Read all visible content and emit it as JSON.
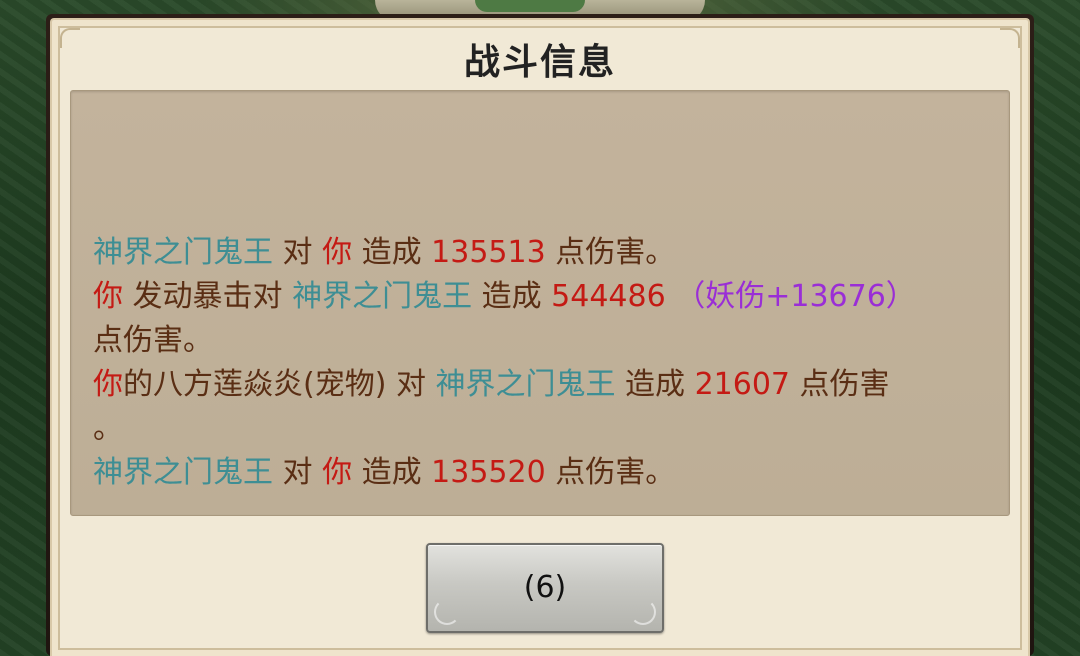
{
  "dialog": {
    "title": "战斗信息",
    "button_label": "(6)"
  },
  "log": [
    {
      "segments": [
        {
          "text": "神界之门鬼王",
          "role": "enemy"
        },
        {
          "text": " 对 ",
          "role": "text"
        },
        {
          "text": "你",
          "role": "you"
        },
        {
          "text": " 造成 ",
          "role": "text"
        },
        {
          "text": "135513",
          "role": "number"
        },
        {
          "text": " 点伤害。",
          "role": "text"
        }
      ]
    },
    {
      "segments": [
        {
          "text": "你",
          "role": "you"
        },
        {
          "text": " 发动暴击对 ",
          "role": "text"
        },
        {
          "text": "神界之门鬼王",
          "role": "enemy"
        },
        {
          "text": " 造成 ",
          "role": "text"
        },
        {
          "text": "544486",
          "role": "number"
        },
        {
          "text": " （妖伤+13676）",
          "role": "bonus"
        }
      ]
    },
    {
      "segments": [
        {
          "text": "点伤害。",
          "role": "text"
        }
      ]
    },
    {
      "segments": [
        {
          "text": "你",
          "role": "you"
        },
        {
          "text": "的八方莲焱炎(宠物) 对 ",
          "role": "text"
        },
        {
          "text": "神界之门鬼王",
          "role": "enemy"
        },
        {
          "text": " 造成 ",
          "role": "text"
        },
        {
          "text": "21607",
          "role": "number"
        },
        {
          "text": " 点伤害",
          "role": "text"
        }
      ]
    },
    {
      "segments": [
        {
          "text": "。",
          "role": "text"
        }
      ]
    },
    {
      "segments": [
        {
          "text": "神界之门鬼王",
          "role": "enemy"
        },
        {
          "text": " 对 ",
          "role": "text"
        },
        {
          "text": "你",
          "role": "you"
        },
        {
          "text": " 造成 ",
          "role": "text"
        },
        {
          "text": "135520",
          "role": "number"
        },
        {
          "text": " 点伤害。",
          "role": "text"
        }
      ]
    }
  ],
  "colors": {
    "enemy": "#3e8e94",
    "you": "#c41a14",
    "number": "#c41a14",
    "text": "#5a2e14",
    "bonus": "#9a2ed6"
  }
}
